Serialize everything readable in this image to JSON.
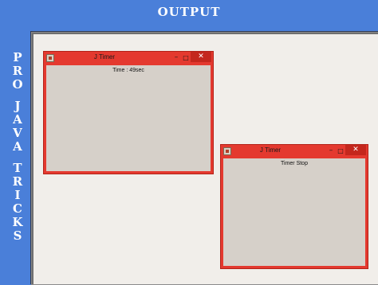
{
  "banner": {
    "title": "OUTPUT"
  },
  "sidebar": {
    "letters": [
      "P",
      "R",
      "O",
      "",
      "J",
      "A",
      "V",
      "A",
      "",
      "T",
      "R",
      "I",
      "C",
      "K",
      "S"
    ]
  },
  "windows": [
    {
      "title": "J Timer",
      "label": "Time : 49sec",
      "controls": {
        "minimize": "–",
        "maximize": "□",
        "close": "✕"
      }
    },
    {
      "title": "J Timer",
      "label": "Timer Stop",
      "controls": {
        "minimize": "–",
        "maximize": "□",
        "close": "✕"
      }
    }
  ],
  "colors": {
    "background": "#4a7fd9",
    "panel": "#f1eeea",
    "window_frame": "#e4392f",
    "window_content": "#d6d0c9"
  }
}
